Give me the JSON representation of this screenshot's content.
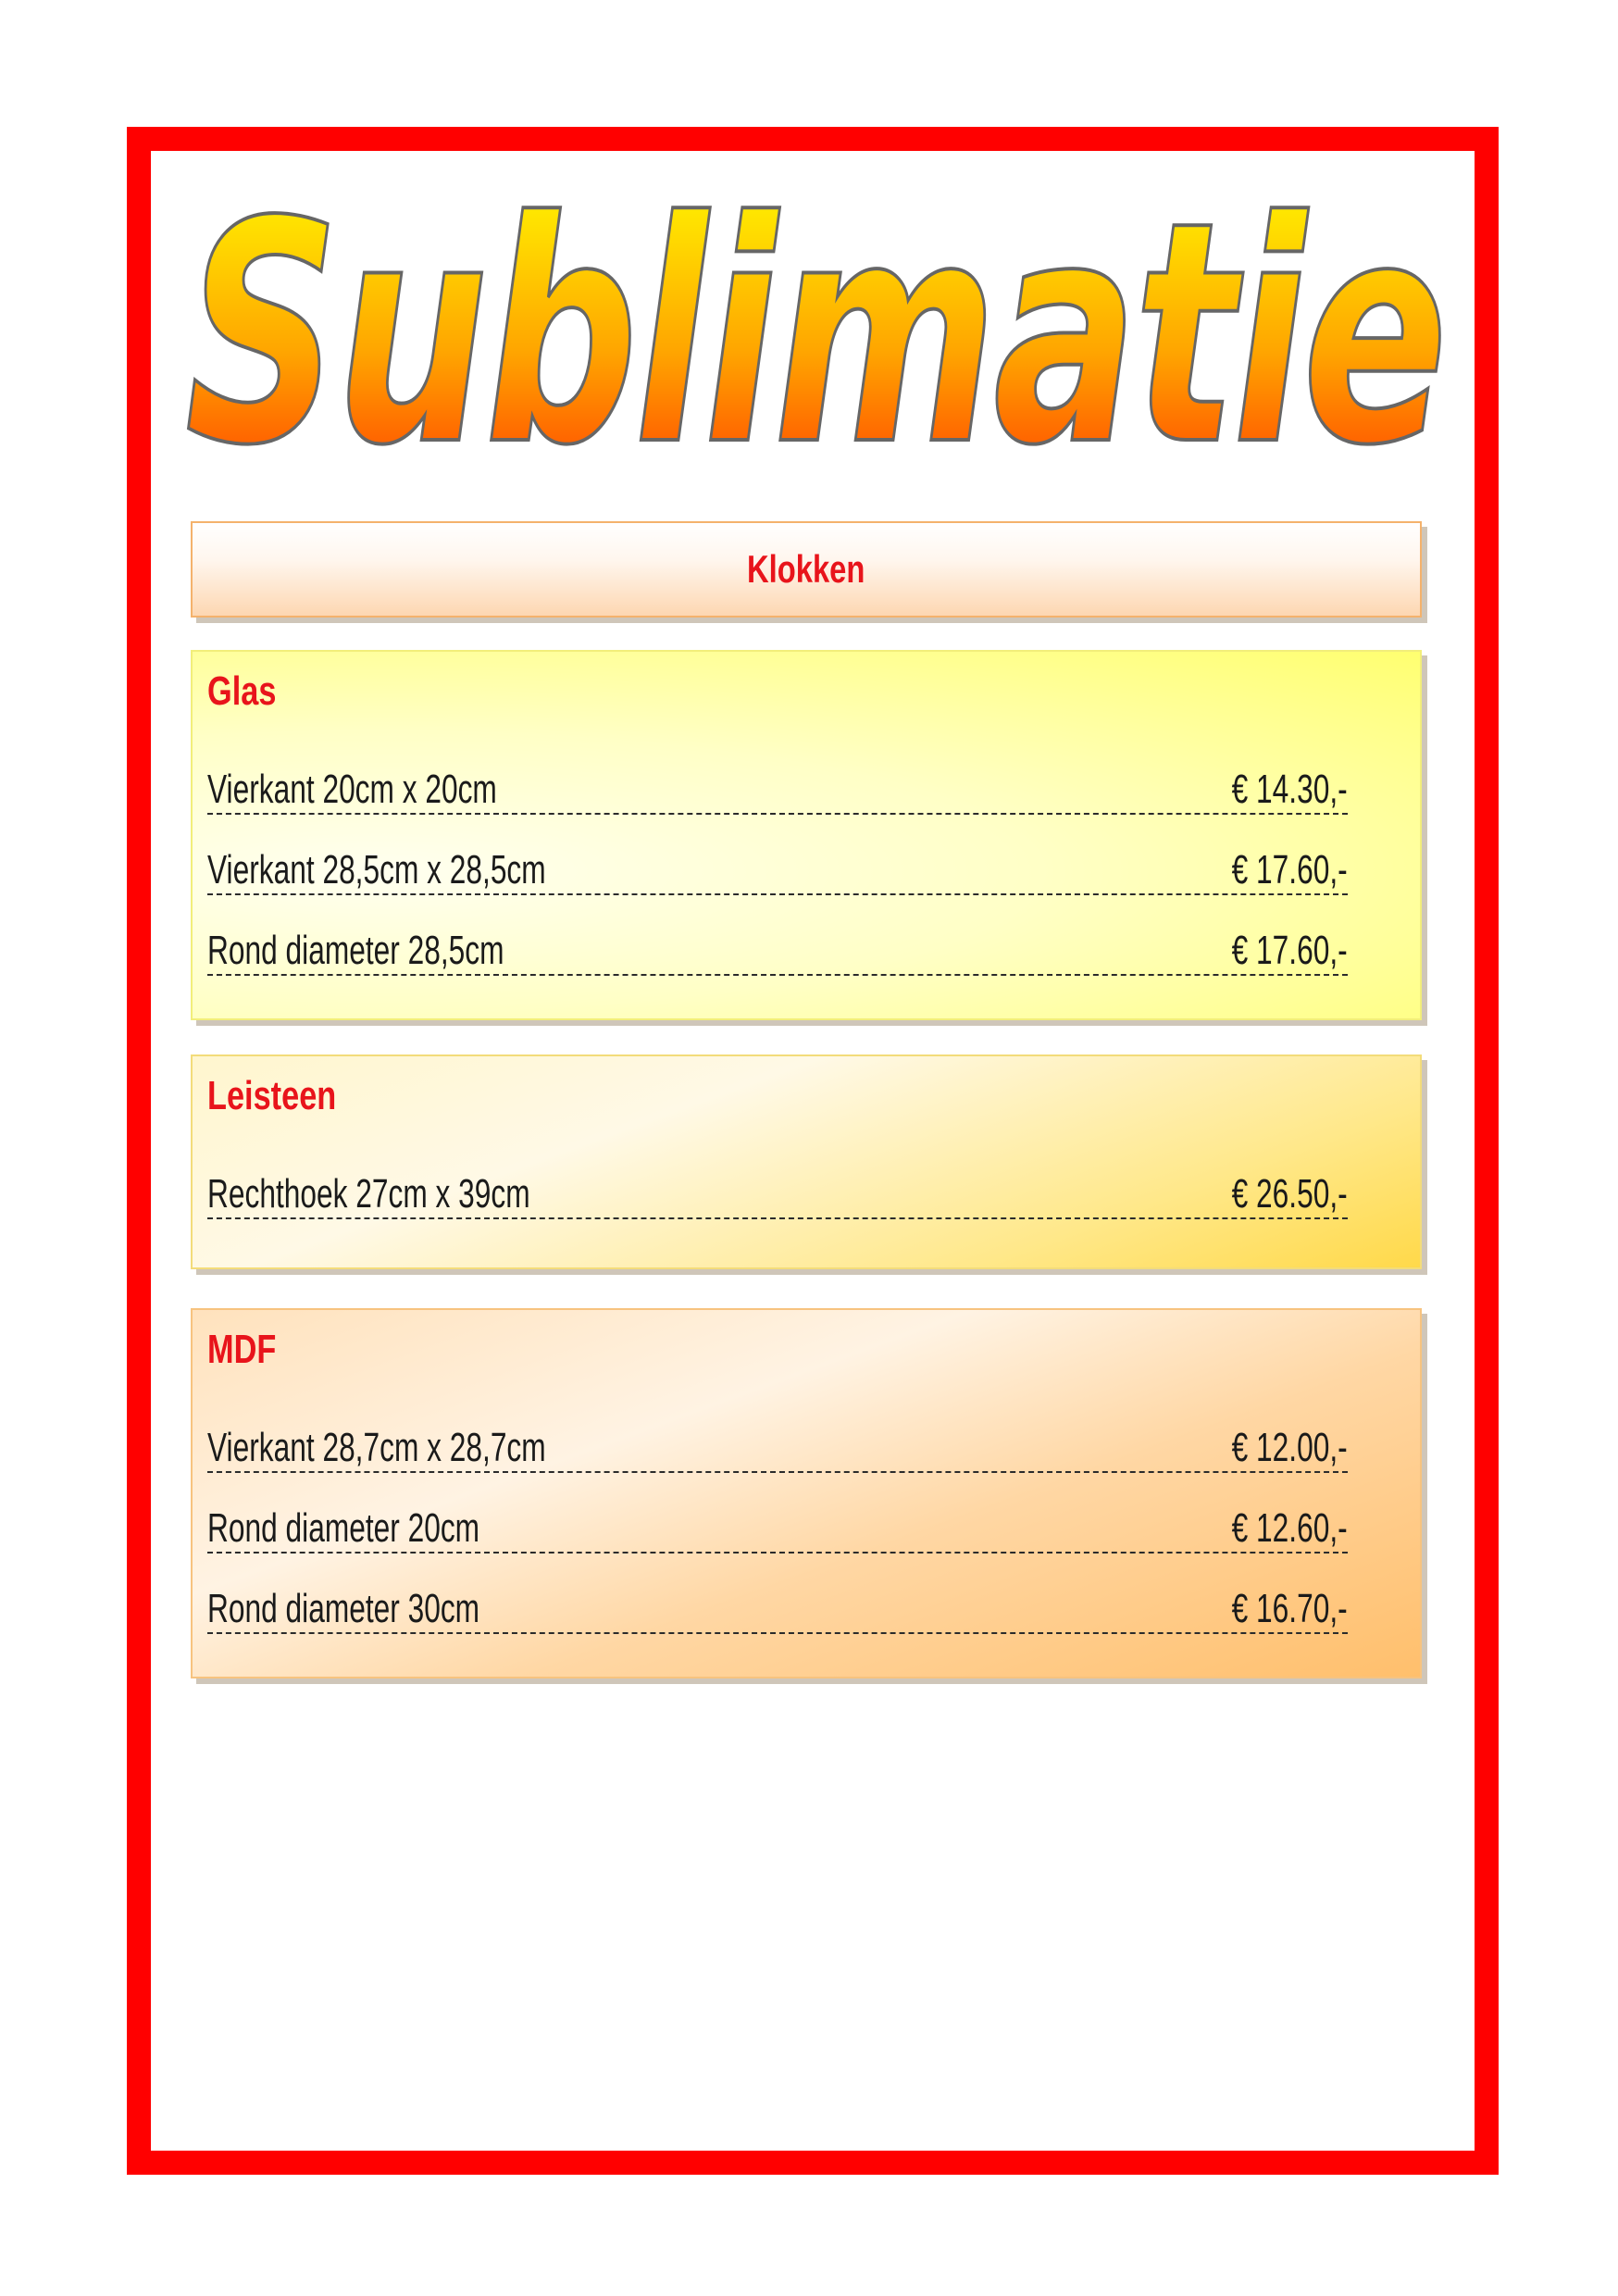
{
  "document": {
    "title": "Sublimatie",
    "heading": "Klokken",
    "sections": [
      {
        "name": "Glas",
        "items": [
          {
            "description": "Vierkant 20cm x 20cm",
            "price": "€ 14.30,-"
          },
          {
            "description": "Vierkant 28,5cm x 28,5cm",
            "price": "€ 17.60,-"
          },
          {
            "description": "Rond diameter 28,5cm",
            "price": "€ 17.60,-"
          }
        ]
      },
      {
        "name": "Leisteen",
        "items": [
          {
            "description": "Rechthoek 27cm x 39cm",
            "price": "€ 26.50,-"
          }
        ]
      },
      {
        "name": "MDF",
        "items": [
          {
            "description": "Vierkant 28,7cm x 28,7cm",
            "price": "€ 12.00,-"
          },
          {
            "description": "Rond diameter 20cm",
            "price": "€ 12.60,-"
          },
          {
            "description": "Rond diameter 30cm",
            "price": "€ 16.70,-"
          }
        ]
      }
    ]
  },
  "colors": {
    "frame": "#ff0000",
    "accent_text": "#e8141b",
    "title_gradient_top": "#ffff00",
    "title_gradient_bottom": "#ff3300",
    "title_outline": "#666666"
  }
}
